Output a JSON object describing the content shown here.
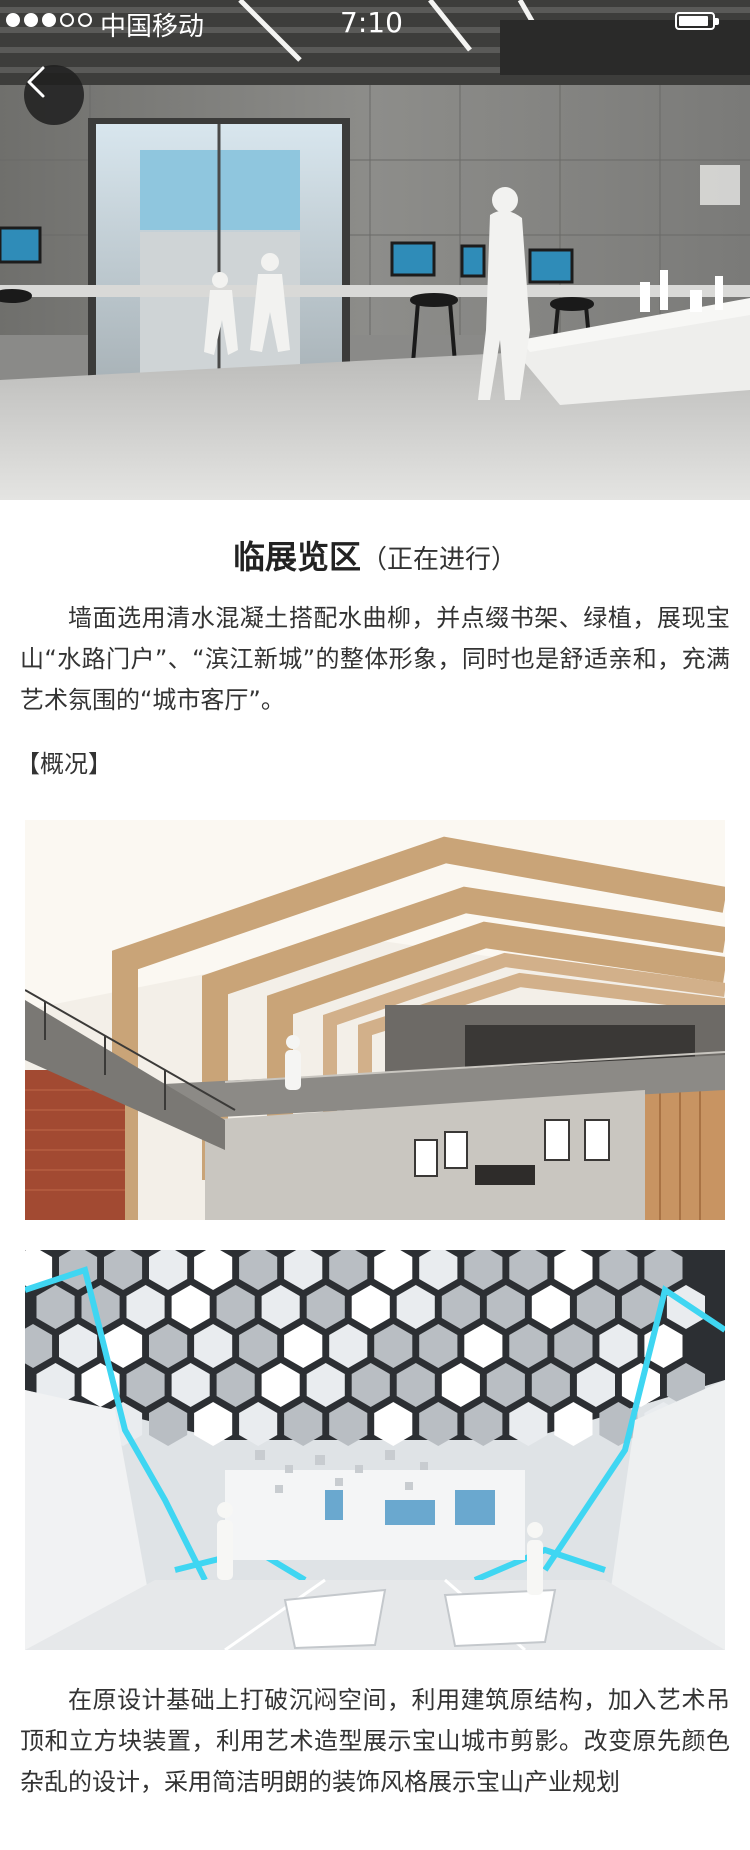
{
  "status_bar": {
    "carrier": "中国移动",
    "time": "7:10",
    "signal_bars_filled": 3,
    "signal_bars_total": 5,
    "battery_level": 0.9
  },
  "header": {
    "back_icon": "chevron-left-icon"
  },
  "article": {
    "title": "临展览区",
    "title_status": "（正在进行）",
    "intro": "墙面选用清水混凝土搭配水曲柳，并点缀书架、绿植，展现宝山“水路门户”、“滨江新城”的整体形象，同时也是舒适亲和，充满艺术氛围的“城市客厅”。",
    "section_label": "【概况】",
    "body": "在原设计基础上打破沉闷空间，利用建筑原结构，加入艺术吊顶和立方块装置，利用艺术造型展示宝山城市剪影。改变原先颜色杂乱的设计，采用简洁明朗的装饰风格展示宝山产业规划"
  },
  "images": {
    "hero": "exhibition-hall-render",
    "photo_1": "wooden-frame-atrium-render",
    "photo_2": "hexagon-ceiling-hall-render"
  }
}
